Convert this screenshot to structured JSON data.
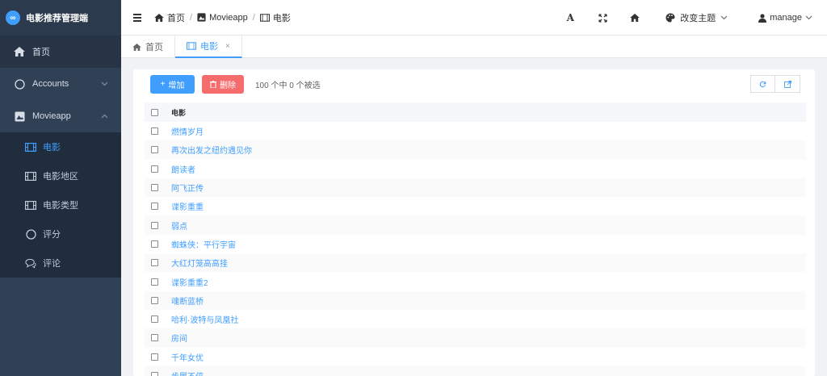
{
  "app": {
    "title": "电影推荐管理端",
    "logo_glyph": "∞"
  },
  "sidebar": {
    "home": "首页",
    "accounts": "Accounts",
    "movieapp": "Movieapp",
    "sub_items": [
      {
        "label": "电影",
        "icon": "film-icon"
      },
      {
        "label": "电影地区",
        "icon": "film-icon"
      },
      {
        "label": "电影类型",
        "icon": "film-icon"
      },
      {
        "label": "评分",
        "icon": "circle-icon"
      },
      {
        "label": "评论",
        "icon": "comment-icon"
      }
    ]
  },
  "header": {
    "breadcrumb": [
      "首页",
      "Movieapp",
      "电影"
    ],
    "font_glyph": "A",
    "theme_label": "改变主题",
    "user_label": "manage"
  },
  "tabs": [
    {
      "label": "首页"
    },
    {
      "label": "电影",
      "close": "×"
    }
  ],
  "toolbar": {
    "add_label": "增加",
    "delete_label": "删除",
    "selection_info": "100 个中 0 个被选"
  },
  "table": {
    "header": "电影",
    "rows": [
      "燃情岁月",
      "再次出发之纽约遇见你",
      "朗读者",
      "阿飞正传",
      "谍影重重",
      "弱点",
      "蜘蛛侠：平行宇宙",
      "大红灯笼高高挂",
      "谍影重重2",
      "魂断蓝桥",
      "哈利·波特与凤凰社",
      "房间",
      "千年女优",
      "步履不停"
    ]
  },
  "colors": {
    "accent": "#409eff",
    "danger": "#f56c6c",
    "sidebar_bg": "#304156"
  }
}
